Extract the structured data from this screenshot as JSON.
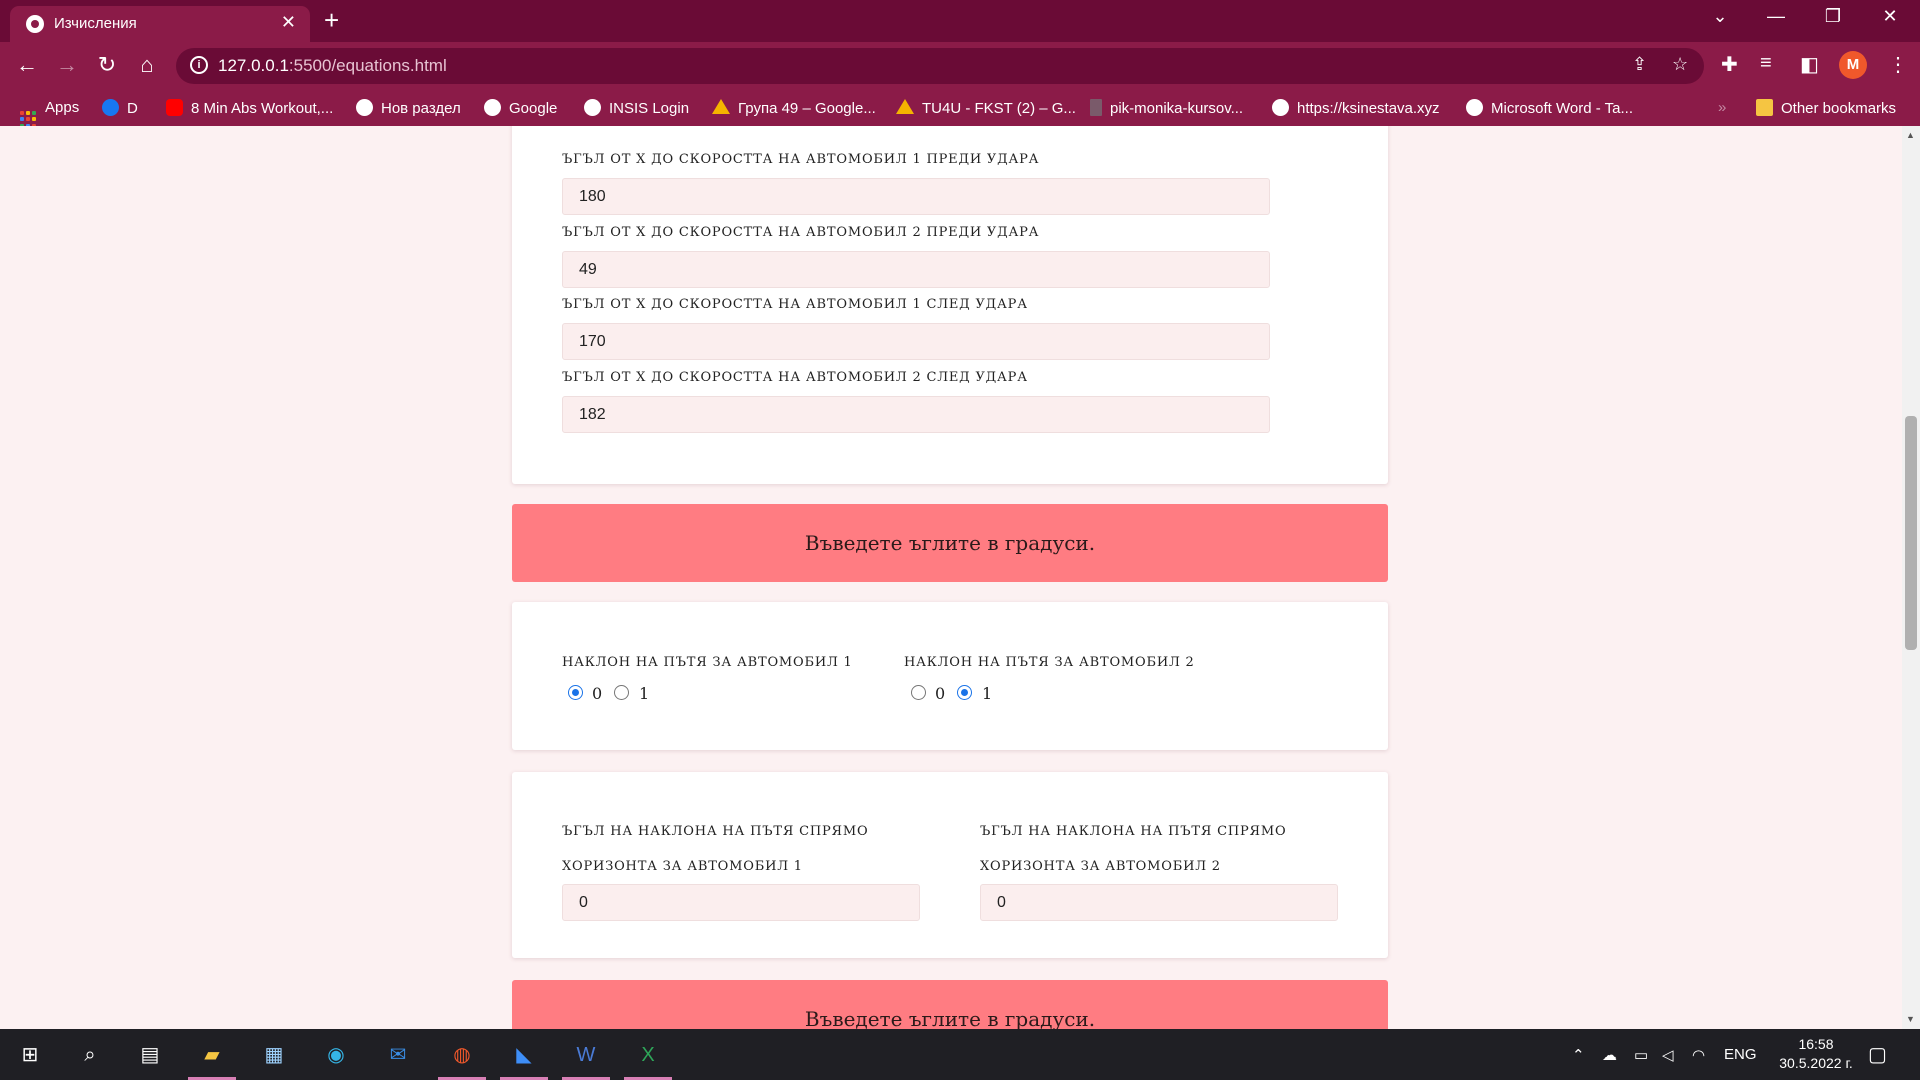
{
  "browser": {
    "tab_title": "Изчисления",
    "url_host": "127.0.0.1",
    "url_path": ":5500/equations.html",
    "profile_initial": "M",
    "bookmarks": [
      {
        "label": "Apps",
        "icon": "apps-grid-icon"
      },
      {
        "label": "D",
        "icon": "facebook-icon"
      },
      {
        "label": "8 Min Abs Workout,...",
        "icon": "youtube-icon"
      },
      {
        "label": "Нов раздел",
        "icon": "globe-icon"
      },
      {
        "label": "Google",
        "icon": "google-icon"
      },
      {
        "label": "INSIS Login",
        "icon": "globe-icon"
      },
      {
        "label": "Група 49 – Google...",
        "icon": "google-drive-icon"
      },
      {
        "label": "TU4U - FKST (2) – G...",
        "icon": "google-drive-icon"
      },
      {
        "label": "pik-monika-kursov...",
        "icon": "document-icon"
      },
      {
        "label": "https://ksinestava.xyz",
        "icon": "globe-icon"
      },
      {
        "label": "Microsoft Word - Ta...",
        "icon": "globe-icon"
      }
    ],
    "more_bookmarks": "»",
    "other_bookmarks": "Other bookmarks"
  },
  "page": {
    "angles_card": {
      "fields": [
        {
          "label": "ъгъл от х до скоростта на автомобил 1 преди удара",
          "value": "180"
        },
        {
          "label": "ъгъл от х до скоростта на автомобил 2 преди удара",
          "value": "49"
        },
        {
          "label": "ъгъл от х до скоростта на автомобил 1 след удара",
          "value": "170"
        },
        {
          "label": "ъгъл от х до скоростта на автомобил 2 след удара",
          "value": "182"
        }
      ]
    },
    "banner_text": "Въведете ъглите в градуси.",
    "slope_card": {
      "car1": {
        "label": "наклон на пътя за автомобил 1",
        "options": [
          "0",
          "1"
        ],
        "selected": "0"
      },
      "car2": {
        "label": "наклон на пътя за автомобил 2",
        "options": [
          "0",
          "1"
        ],
        "selected": "1"
      }
    },
    "slope_angle_card": {
      "car1": {
        "label_line1": "ъгъл на наклона на пътя спрямо",
        "label_line2": "хоризонта за автомобил 1",
        "value": "0"
      },
      "car2": {
        "label_line1": "ъгъл на наклона на пътя спрямо",
        "label_line2": "хоризонта за автомобил 2",
        "value": "0"
      }
    },
    "banner2_text": "Въведете ъглите в градуси."
  },
  "taskbar": {
    "language": "ENG",
    "time": "16:58",
    "date": "30.5.2022 г."
  }
}
